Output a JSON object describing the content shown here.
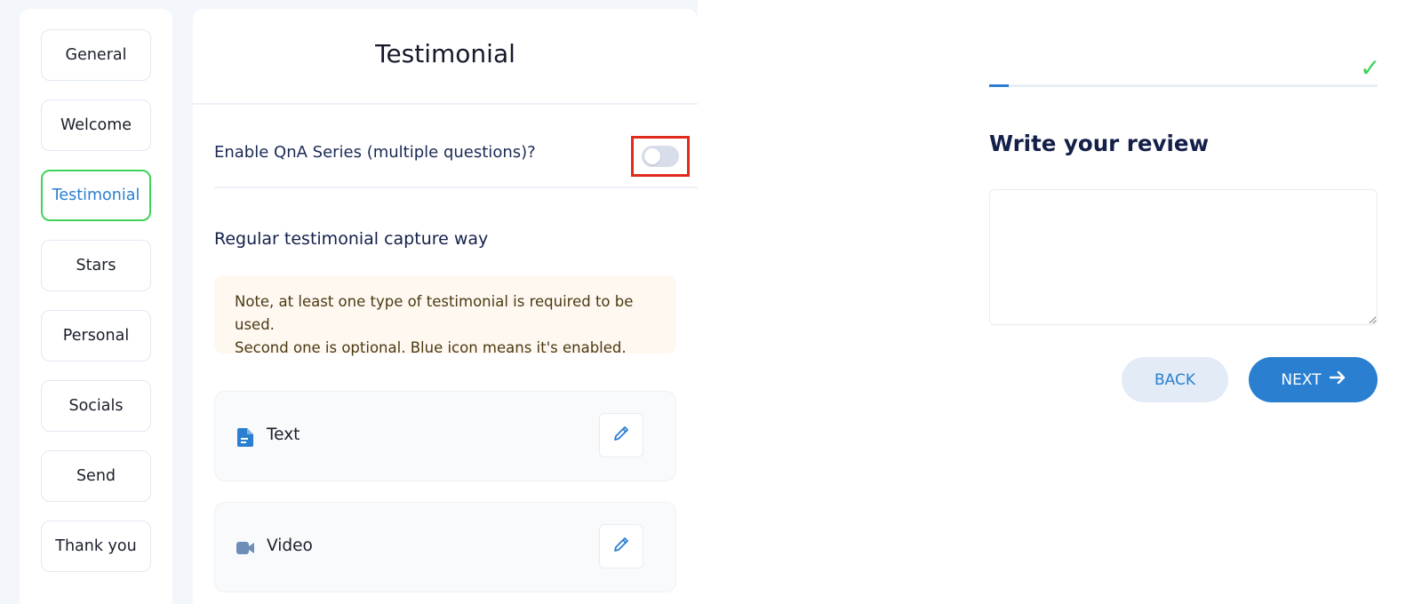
{
  "sidebar": {
    "items": [
      {
        "label": "General"
      },
      {
        "label": "Welcome"
      },
      {
        "label": "Testimonial"
      },
      {
        "label": "Stars"
      },
      {
        "label": "Personal"
      },
      {
        "label": "Socials"
      },
      {
        "label": "Send"
      },
      {
        "label": "Thank you"
      }
    ],
    "active": "Testimonial"
  },
  "panel": {
    "title": "Testimonial",
    "qna_label": "Enable QnA Series (multiple questions)?",
    "qna_enabled": false,
    "section_title": "Regular testimonial capture way",
    "note_line1": "Note, at least one type of testimonial is required to be used.",
    "note_line2": "Second one is optional. Blue icon means it's enabled.",
    "types": [
      {
        "label": "Text",
        "icon": "document-icon",
        "enabled": true
      },
      {
        "label": "Video",
        "icon": "video-camera-icon",
        "enabled": false
      }
    ]
  },
  "preview": {
    "progress": 0.05,
    "review_title": "Write your review",
    "review_placeholder": "",
    "back_label": "BACK",
    "next_label": "NEXT"
  },
  "colors": {
    "accent": "#2a7fd1",
    "active_border": "#3fd35b",
    "highlight": "#e02a1c",
    "note_bg": "#fff8f1"
  }
}
